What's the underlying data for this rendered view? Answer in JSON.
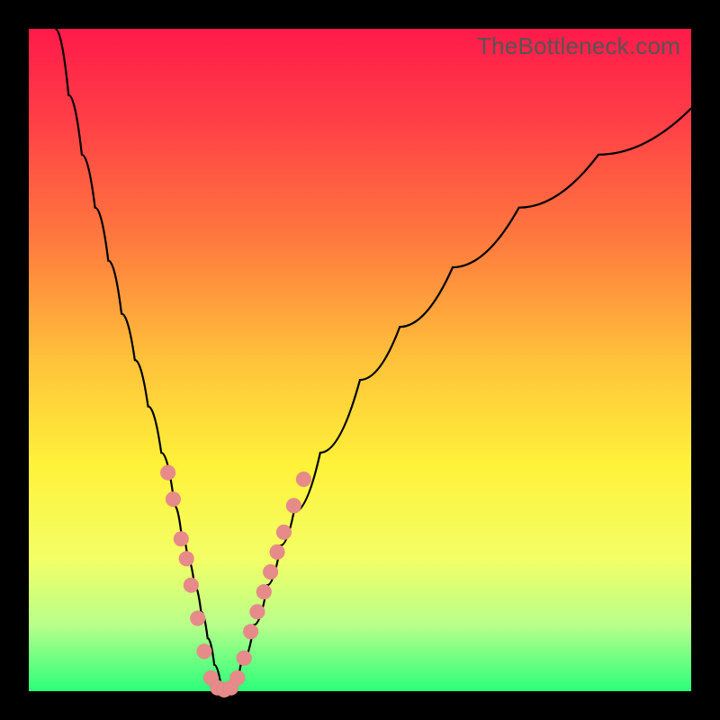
{
  "watermark": {
    "text": "TheBottleneck.com"
  },
  "gradient": {
    "stops": [
      {
        "pct": 0,
        "color": "#ff1a4a"
      },
      {
        "pct": 14,
        "color": "#ff3f46"
      },
      {
        "pct": 32,
        "color": "#ff7a3e"
      },
      {
        "pct": 50,
        "color": "#ffc23a"
      },
      {
        "pct": 66,
        "color": "#fff23a"
      },
      {
        "pct": 80,
        "color": "#f3ff66"
      },
      {
        "pct": 90,
        "color": "#b8ff8a"
      },
      {
        "pct": 100,
        "color": "#2bff7a"
      }
    ]
  },
  "chart_data": {
    "type": "line",
    "title": "",
    "xlabel": "",
    "ylabel": "",
    "xlim": [
      0,
      100
    ],
    "ylim": [
      0,
      100
    ],
    "grid": false,
    "series": [
      {
        "name": "bottleneck-curve",
        "x": [
          4,
          6,
          8,
          10,
          12,
          14,
          16,
          18,
          20,
          22,
          23,
          24,
          25,
          26,
          27,
          28,
          29,
          30,
          31,
          32,
          34,
          36,
          38,
          40,
          44,
          50,
          56,
          64,
          74,
          86,
          100
        ],
        "y": [
          100,
          90,
          81,
          73,
          65,
          57,
          50,
          43,
          36,
          28,
          24,
          20,
          16,
          12,
          8,
          4,
          1,
          0,
          1,
          4,
          10,
          16,
          22,
          27,
          36,
          47,
          55,
          64,
          73,
          81,
          88
        ]
      }
    ],
    "scatter": {
      "name": "sample-points",
      "color": "#e78a8a",
      "points": [
        {
          "x": 21.0,
          "y": 33
        },
        {
          "x": 21.8,
          "y": 29
        },
        {
          "x": 23.0,
          "y": 23
        },
        {
          "x": 23.8,
          "y": 20
        },
        {
          "x": 24.5,
          "y": 16
        },
        {
          "x": 25.5,
          "y": 11
        },
        {
          "x": 26.5,
          "y": 6
        },
        {
          "x": 27.5,
          "y": 2
        },
        {
          "x": 28.5,
          "y": 0.5
        },
        {
          "x": 29.5,
          "y": 0.2
        },
        {
          "x": 30.5,
          "y": 0.5
        },
        {
          "x": 31.5,
          "y": 2
        },
        {
          "x": 32.5,
          "y": 5
        },
        {
          "x": 33.5,
          "y": 9
        },
        {
          "x": 34.5,
          "y": 12
        },
        {
          "x": 35.5,
          "y": 15
        },
        {
          "x": 36.5,
          "y": 18
        },
        {
          "x": 37.5,
          "y": 21
        },
        {
          "x": 38.5,
          "y": 24
        },
        {
          "x": 40.0,
          "y": 28
        },
        {
          "x": 41.5,
          "y": 32
        }
      ]
    }
  }
}
